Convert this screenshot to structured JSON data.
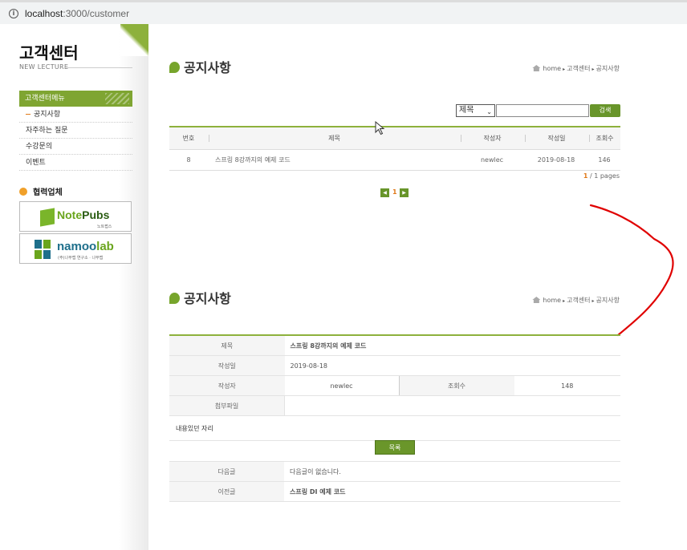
{
  "browser": {
    "url_host": "localhost",
    "url_path": ":3000/customer"
  },
  "aside": {
    "title": "고객센터",
    "subtitle": "NEW LECTURE",
    "menu_heading": "고객센터메뉴",
    "menu_items": [
      "공지사항",
      "자주하는 질문",
      "수강문의",
      "이벤트"
    ],
    "partner_heading": "협력업체",
    "partners": [
      {
        "name_a": "Note",
        "name_b": "Pubs",
        "tagline": "노트펍스"
      },
      {
        "name_a": "namoo",
        "name_b": "lab",
        "tagline": "(주)나무랩 연구소 · 나무랩"
      }
    ]
  },
  "list_page": {
    "title": "공지사항",
    "breadcrumb": [
      "home",
      "고객센터",
      "공지사항"
    ],
    "search": {
      "field_selected": "제목",
      "button": "검색",
      "query": ""
    },
    "columns": [
      "번호",
      "제목",
      "작성자",
      "작성일",
      "조회수"
    ],
    "rows": [
      {
        "no": "8",
        "title": "스프링 8강까지의 예제 코드",
        "writer": "newlec",
        "date": "2019-08-18",
        "hit": "146"
      }
    ],
    "page_info": {
      "current": "1",
      "total": "/ 1 pages"
    },
    "pager": {
      "prev": "◀",
      "current": "1",
      "next": "▶"
    }
  },
  "detail_page": {
    "title": "공지사항",
    "breadcrumb": [
      "home",
      "고객센터",
      "공지사항"
    ],
    "labels": {
      "title": "제목",
      "date": "작성일",
      "writer": "작성자",
      "hit": "조회수",
      "file": "첨부파일"
    },
    "values": {
      "title": "스프링 8강까지의 예제 코드",
      "date": "2019-08-18",
      "writer": "newlec",
      "hit": "148",
      "file": ""
    },
    "content": "내용있던 자리",
    "list_button": "목록",
    "nav": [
      {
        "label": "다음글",
        "value": "다음글이 없습니다."
      },
      {
        "label": "이전글",
        "value": "스프링 DI 예제 코드"
      }
    ]
  },
  "colors": {
    "accent_green": "#7fa532",
    "highlight_orange": "#d2691e",
    "annotation_red": "#e00000"
  }
}
